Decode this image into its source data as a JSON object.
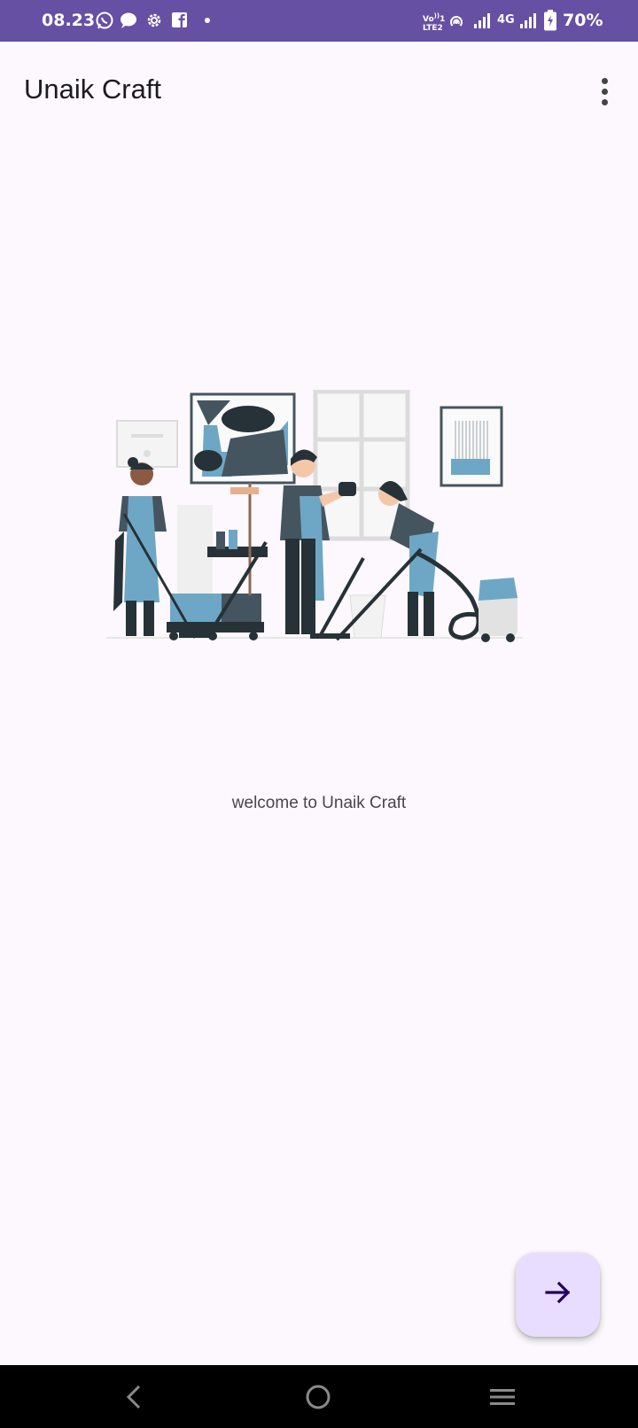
{
  "status_bar": {
    "time": "08.23",
    "network": "4G",
    "volte": "Vo))\nLTE2",
    "battery": "70%",
    "icons": [
      "whatsapp-icon",
      "message-icon",
      "settings-icon",
      "facebook-icon",
      "dot-icon",
      "volte-icon",
      "hotspot-icon",
      "signal-icon",
      "signal-icon",
      "battery-icon"
    ],
    "background": "#6650a4"
  },
  "app_bar": {
    "title": "Unaik Craft",
    "menu_icon": "more-vert-icon"
  },
  "main": {
    "illustration": "cleaning-team-illustration",
    "welcome_text": "welcome to Unaik Craft"
  },
  "fab": {
    "icon": "arrow-forward-icon",
    "color": "#e9ddff",
    "icon_color": "#21005d"
  },
  "nav_bar": {
    "back_icon": "back-icon",
    "home_icon": "home-icon",
    "recents_icon": "recents-icon"
  }
}
